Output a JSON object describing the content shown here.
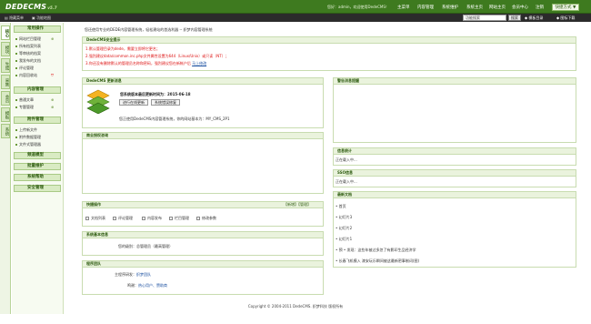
{
  "header": {
    "logo": "DEDECMS",
    "logo_version": "v5.7",
    "welcome": "您好：admin，欢迎使用DedeCMS！",
    "nav": [
      "主菜单",
      "内容管理",
      "系统维护",
      "系统主页",
      "网站主页",
      "会员中心",
      "注销"
    ],
    "quick": "快捷方式 ▼"
  },
  "subbar": {
    "left": [
      "隐藏菜单",
      "功能地图"
    ],
    "search_value": "功能搜索",
    "search_btn": "搜索",
    "right": [
      "模板目录",
      "图标下载"
    ]
  },
  "lefttabs": [
    "核心",
    "模块",
    "生成",
    "采集",
    "会员",
    "模板",
    "系统"
  ],
  "leftmenu": {
    "groups": [
      {
        "title": "常用操作",
        "items": [
          "网站栏目管理",
          "所有档案列表",
          "等审核的档案",
          "我发布的文档",
          "评论管理",
          "内容回收站"
        ]
      },
      {
        "title": "内容管理",
        "items": [
          "普通文章",
          "专题管理"
        ]
      },
      {
        "title": "附件管理",
        "items": [
          "上传新文件",
          "附件数据管理",
          "文件式管理器"
        ]
      },
      {
        "title": "频道模型",
        "items": []
      },
      {
        "title": "批量维护",
        "items": []
      },
      {
        "title": "系统帮助",
        "items": []
      },
      {
        "title": "安全管理",
        "items": []
      }
    ]
  },
  "breadcrumb": "您还使用专业的DEDE内容管理系统，轻松建站的首选利器 -- 织梦内容管理系统",
  "security": {
    "title": "DedeCMS安全提示",
    "lines": [
      "1.默认管理目录为dede，需要立即将它更名；",
      "2.强烈建议data/common.inc.php文件属性设置为644（Linux/Unix）或只读（NT）；",
      "3.你还没有删除默认的管理员名称和密码，强烈建议您在新帐户后 "
    ],
    "fix_link": "马上修改"
  },
  "update": {
    "title": "DedeCMS 更新消息",
    "release": "您系统版本最后更新时间为：2015-06-18",
    "btn1": "进行在线更新",
    "btn2": "系统错误修复",
    "desc": "您正使用DedeCMS内容管理系统，你的网站基本为：MY_CMS_2P1"
  },
  "business": {
    "title": "商业授权咨询"
  },
  "quickops": {
    "title": "快捷操作",
    "links": "【新增】【管理】",
    "items": [
      "文档列表",
      "评论管理",
      "内容发布",
      "栏目管理",
      "修改参数"
    ]
  },
  "sysinfo": {
    "title": "系统基本信息",
    "label": "您的级别：",
    "value": "总管理员（最高管理）"
  },
  "team": {
    "title": "程序团队",
    "rows": [
      {
        "label": "主程序研发：",
        "value": "织梦团队"
      },
      {
        "label": "鸣谢：",
        "value": "热心用户、赞助商"
      }
    ]
  },
  "news": {
    "title": "警告消息提醒"
  },
  "stats": {
    "title": "信息统计",
    "label": "正在载入中..."
  },
  "ssl": {
    "title": "SSO信息",
    "label": "正在载入中..."
  },
  "docs": {
    "title": "最新文档",
    "items": [
      "• 首页",
      "• 幻灯片3",
      "• 幻灯片2",
      "• 幻灯片1",
      "• 预 • 发现：这些年被过多忽了有影印生品经济学",
      "• 长春飞机模入 漆安玩乐瞬间被这最新密事制词(图)"
    ]
  },
  "footer": "Copyright © 2004-2011 DedeCMS. 织梦科技 版权所有"
}
